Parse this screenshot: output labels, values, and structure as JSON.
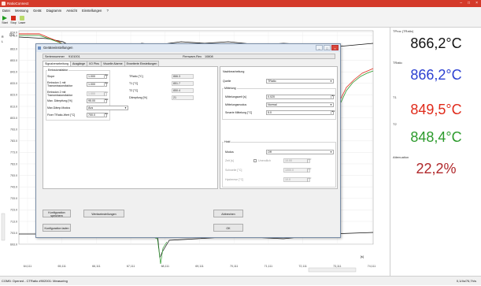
{
  "app": {
    "title": "RatioConnect",
    "min": "–",
    "max": "□",
    "close": "×"
  },
  "menu": [
    "Datei",
    "Messung",
    "Gerät",
    "Diagramm",
    "Ansicht",
    "Einstellungen",
    "?"
  ],
  "toolbar": {
    "start": "Start",
    "stop": "Stop",
    "laser": "Laser"
  },
  "chart": {
    "y_ticks": [
      "874.0",
      "873.0",
      "863.0",
      "853.0",
      "843.0",
      "833.0",
      "823.0",
      "813.0",
      "803.0",
      "793.0",
      "783.0",
      "773.0",
      "763.0",
      "753.0",
      "743.0",
      "733.0",
      "723.0",
      "713.0",
      "703.0",
      "693.0"
    ],
    "x_ticks": [
      "64,111",
      "65,111",
      "66,111",
      "67,111",
      "68,111",
      "69,111",
      "70,111",
      "71,111",
      "72,111",
      "73,111",
      "74,111"
    ],
    "y_unit": "[°C]",
    "x_unit": "[s]",
    "legend": [
      "R",
      "L"
    ],
    "colors": {
      "black": "#111111",
      "red": "#e02a1a",
      "green": "#2b9a2b"
    }
  },
  "panel": [
    {
      "label": "TProc (TRatio)",
      "value": "866,2°C",
      "color": "#111111"
    },
    {
      "label": "TRatio",
      "value": "866,2°C",
      "color": "#2b3fd1"
    },
    {
      "label": "T1",
      "value": "849,5°C",
      "color": "#e02a1a"
    },
    {
      "label": "T2",
      "value": "848,4°C",
      "color": "#2b9a2b"
    },
    {
      "label": "Attenuation",
      "value": "22,2%",
      "color": "#b0282b"
    }
  ],
  "status": {
    "left": "COM5: Opened - CTRatio #902001: Measuring",
    "right": "0,1/4s/76,7h/s"
  },
  "dialog": {
    "title": "Geräteeinstellungen",
    "serial_label": "Seriennummer",
    "serial_value": "9101001",
    "fw_label": "Firmware-Rev.",
    "fw_value": "10808",
    "tabs": [
      "Signalverarbeitung",
      "Ausgänge",
      "I/O Pins",
      "Visuelle Alarme",
      "Erweiterte Einstellungen"
    ],
    "emissivity_group": "Emissionsfaktor",
    "rows": [
      {
        "label": "Slope",
        "value": "1.000",
        "disabled": false
      },
      {
        "label": "Emission 1 mit Transmissionsfaktor",
        "value": "1.000",
        "disabled": false
      },
      {
        "label": "Emission 2 mit Transmissionsfaktor",
        "value": "1.000",
        "disabled": true
      },
      {
        "label": "Max. Dämpfung [%]",
        "value": "95.00",
        "disabled": false
      },
      {
        "label": "Max.Dämp.Modus",
        "value": "Aus",
        "disabled": false
      },
      {
        "label": "Fixer TRatio-Wert [°C]",
        "value": "700.0",
        "disabled": false
      }
    ],
    "readouts": [
      {
        "label": "TRatio [°C]",
        "value": "866.3"
      },
      {
        "label": "T1 [°C]",
        "value": "851.7"
      },
      {
        "label": "T2 [°C]",
        "value": "850.4"
      },
      {
        "label": "Dämpfung [%]",
        "value": "21"
      }
    ],
    "post": {
      "title": "Nachbearbeitung",
      "source_label": "Quelle",
      "source_value": "TRatio",
      "avg_group": "Mittelung",
      "avg_time_label": "Mittelungszeit [s]",
      "avg_time_value": "0.020",
      "avg_mode_label": "Mittelungsmodus",
      "avg_mode_value": "Normal",
      "smart_label": "Smarte Mittelung [°C]",
      "smart_value": "5.0",
      "hold_group": "Hold",
      "mode_label": "Modus",
      "mode_value": "Off",
      "time_label": "Zeit [s]",
      "time_value": "10.00",
      "unlimited_label": "Unendlich",
      "threshold_label": "Schwelle [°C]",
      "threshold_value": "1000.0",
      "hyst_label": "Hysterese [°C]",
      "hyst_value": "10.0"
    },
    "buttons": {
      "save_config": "Konfiguration speichern",
      "factory": "Werkseinstellungen",
      "load_config": "Konfiguration laden",
      "cancel": "Abbrechen",
      "ok": "OK"
    }
  }
}
